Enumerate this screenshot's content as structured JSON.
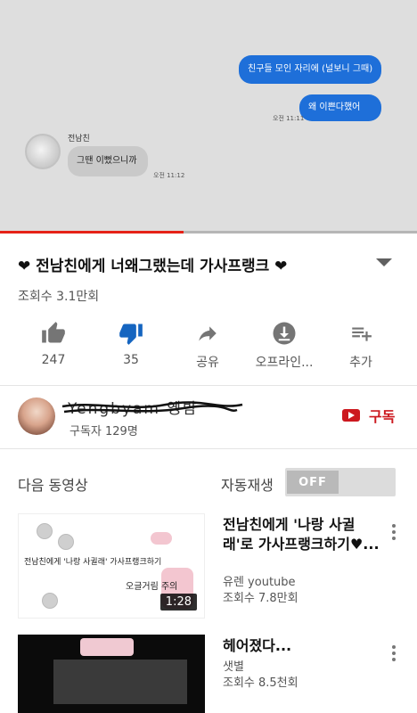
{
  "player": {
    "messages": [
      {
        "text": "친구들 모인 자리에 (널보니 그때)",
        "side": "right"
      },
      {
        "text": "왜 이쁜다했어",
        "side": "right"
      },
      {
        "text": "그땐 이뻤으니까",
        "side": "left"
      }
    ],
    "sender_name": "전남친",
    "time_sent": "오전 11:11",
    "time_received": "오전 11:12",
    "progress": 0.44,
    "colors": {
      "progress": "#e62117",
      "bubble_blue": "#1e6fd9"
    }
  },
  "video": {
    "title": "❤ 전남친에게 너왜그랬는데 가사프랭크 ❤",
    "views": "조회수 3.1만회"
  },
  "actions": [
    {
      "icon": "thumbs-up-icon",
      "label": "247"
    },
    {
      "icon": "thumbs-down-icon",
      "label": "35"
    },
    {
      "icon": "share-icon",
      "label": "공유"
    },
    {
      "icon": "download-icon",
      "label": "오프라인..."
    },
    {
      "icon": "add-to-playlist-icon",
      "label": "추가"
    }
  ],
  "channel": {
    "name": "Yengbyam 옝뱜",
    "subscribers": "구독자 129명",
    "subscribe_label": "구독"
  },
  "up_next": {
    "heading": "다음 동영상",
    "autoplay_label": "자동재생",
    "autoplay_state": "OFF",
    "videos": [
      {
        "title": "전남친에게 '나랑 사귈래'로 가사프랭크하기♥...",
        "channel": "유렌 youtube",
        "views": "조회수 7.8만회",
        "duration": "1:28",
        "thumb_text": "전남친에게 '나랑 사귈래' 가사프랭크하기",
        "thumb_text2": "오글거림 주의"
      },
      {
        "title": "헤어졌다...",
        "channel": "샛별",
        "views": "조회수 8.5천회"
      }
    ]
  }
}
